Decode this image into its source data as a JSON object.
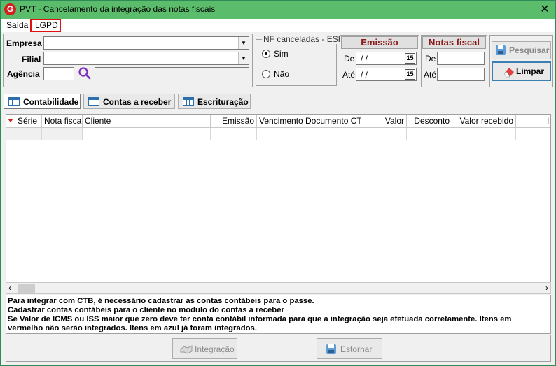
{
  "window": {
    "title": "PVT - Cancelamento da integração das notas fiscais",
    "app_icon": "G",
    "close_glyph": "✕"
  },
  "menu": {
    "items": [
      "Saída",
      "LGPD"
    ]
  },
  "filters": {
    "empresa_label": "Empresa",
    "filial_label": "Filial",
    "agencia_label": "Agência",
    "empresa_value": "",
    "filial_value": "",
    "agencia_value": "",
    "agencia_desc": ""
  },
  "nf_group": {
    "legend": "NF canceladas - ESF",
    "options": [
      {
        "label": "Sim",
        "checked": true
      },
      {
        "label": "Não",
        "checked": false
      }
    ]
  },
  "emissao": {
    "title": "Emissão",
    "de_label": "De",
    "ate_label": "Até",
    "de_value": "/ /",
    "ate_value": "/ /",
    "calendar_glyph": "15"
  },
  "notas": {
    "title": "Notas fiscal",
    "de_label": "De",
    "ate_label": "Até",
    "de_value": "",
    "ate_value": ""
  },
  "actions": {
    "pesquisar": "Pesquisar",
    "limpar": "Limpar"
  },
  "tabs": [
    {
      "label": "Contabilidade",
      "active": true
    },
    {
      "label": "Contas a receber",
      "active": false
    },
    {
      "label": "Escrituração",
      "active": false
    }
  ],
  "grid": {
    "columns": [
      "Série",
      "Nota fiscal",
      "Cliente",
      "Emissão",
      "Vencimento",
      "Documento CTB",
      "Valor",
      "Desconto",
      "Valor recebido",
      "IS"
    ]
  },
  "info_lines": [
    "Para integrar com CTB, é necessário cadastrar as contas contábeis para o passe.",
    "Cadastrar contas contábeis para o cliente no modulo do contas a receber",
    "Se Valor de ICMS ou ISS maior que zero deve ter conta contábil informada para que a integração seja efetuada corretamente. Itens em",
    "vermelho não serão integrados. Itens em azul já foram integrados."
  ],
  "footer": {
    "integracao": "Integração",
    "estornar": "Estornar"
  },
  "colors": {
    "titlebar": "#5bbd6b",
    "section_title": "#8b1a1a",
    "highlight_box": "#e01010"
  }
}
